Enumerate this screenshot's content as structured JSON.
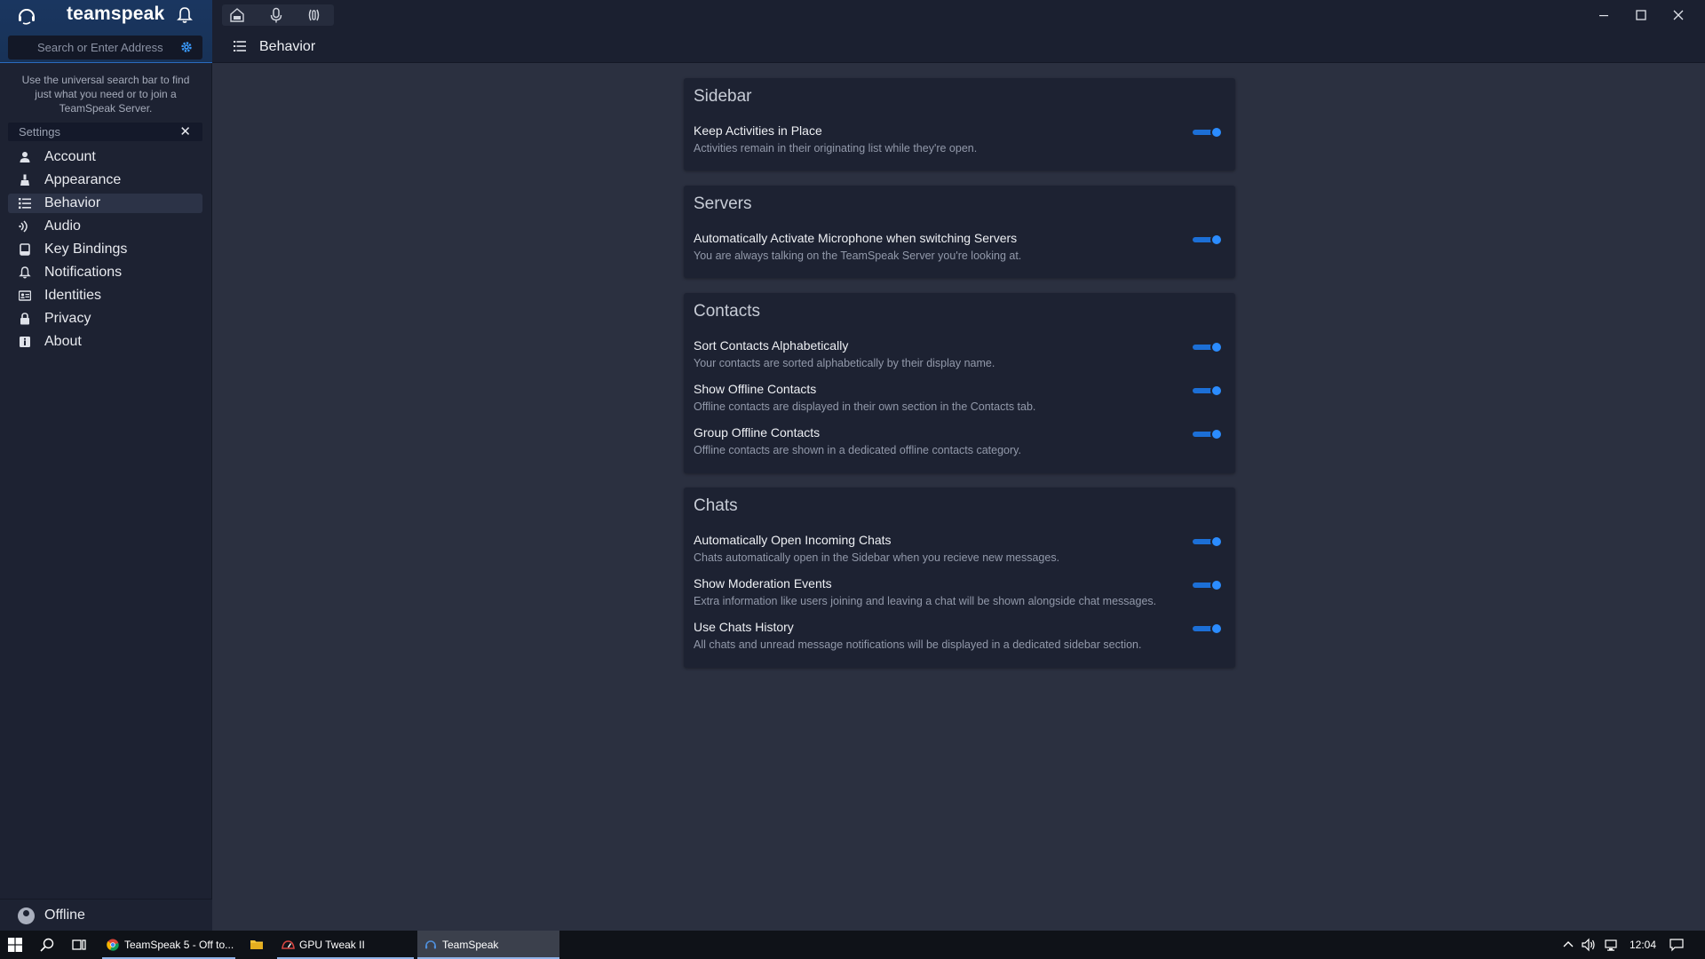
{
  "app": {
    "brand": "teamspeak",
    "search_placeholder": "Search or Enter Address",
    "hint": "Use the universal search bar to find just what you need or to join a TeamSpeak Server.",
    "settings_filter": "Settings",
    "accent": "#2b8cff"
  },
  "nav": {
    "items": [
      {
        "label": "Account",
        "icon": "user-icon"
      },
      {
        "label": "Appearance",
        "icon": "brush-icon"
      },
      {
        "label": "Behavior",
        "icon": "list-icon"
      },
      {
        "label": "Audio",
        "icon": "audio-icon"
      },
      {
        "label": "Key Bindings",
        "icon": "keyboard-icon"
      },
      {
        "label": "Notifications",
        "icon": "bell-icon"
      },
      {
        "label": "Identities",
        "icon": "identity-icon"
      },
      {
        "label": "Privacy",
        "icon": "lock-icon"
      },
      {
        "label": "About",
        "icon": "info-icon"
      }
    ],
    "active_index": 2
  },
  "status": {
    "label": "Offline"
  },
  "header": {
    "title": "Behavior"
  },
  "sections": {
    "sidebar": {
      "title": "Sidebar",
      "rows": [
        {
          "title": "Keep Activities in Place",
          "desc": "Activities remain in their originating list while they're open.",
          "on": true
        }
      ]
    },
    "servers": {
      "title": "Servers",
      "rows": [
        {
          "title": "Automatically Activate Microphone when switching Servers",
          "desc": "You are always talking on the TeamSpeak Server you're looking at.",
          "on": true
        }
      ]
    },
    "contacts": {
      "title": "Contacts",
      "rows": [
        {
          "title": "Sort Contacts Alphabetically",
          "desc": "Your contacts are sorted alphabetically by their display name.",
          "on": true
        },
        {
          "title": "Show Offline Contacts",
          "desc": "Offline contacts are displayed in their own section in the Contacts tab.",
          "on": true
        },
        {
          "title": "Group Offline Contacts",
          "desc": "Offline contacts are shown in a dedicated offline contacts category.",
          "on": true
        }
      ]
    },
    "chats": {
      "title": "Chats",
      "rows": [
        {
          "title": "Automatically Open Incoming Chats",
          "desc": "Chats automatically open in the Sidebar when you recieve new messages.",
          "on": true
        },
        {
          "title": "Show Moderation Events",
          "desc": "Extra information like users joining and leaving a chat will be shown alongside chat messages.",
          "on": true
        },
        {
          "title": "Use Chats History",
          "desc": "All chats and unread message notifications will be displayed in a dedicated sidebar section.",
          "on": true
        }
      ]
    }
  },
  "taskbar": {
    "apps": [
      {
        "label": "TeamSpeak 5 - Off to..."
      },
      {
        "label": "GPU Tweak II"
      },
      {
        "label": "TeamSpeak"
      }
    ],
    "clock": "12:04"
  }
}
